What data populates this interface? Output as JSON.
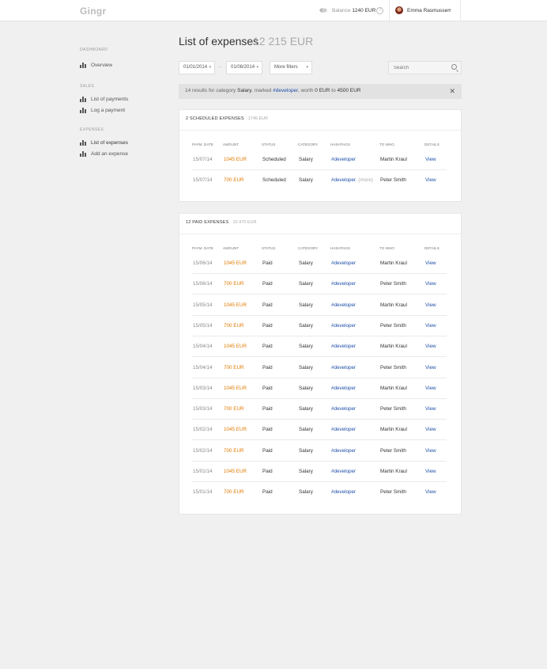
{
  "header": {
    "logo": "Gingr",
    "balance_label": "Balance",
    "balance_value": "1240 EUR",
    "help": "?",
    "user_name": "Emma Rasmussen",
    "user_caret": "▾"
  },
  "sidebar": {
    "sections": [
      {
        "title": "DASHBOARD",
        "items": [
          {
            "label": "Overview",
            "active": false
          }
        ]
      },
      {
        "title": "SALES",
        "items": [
          {
            "label": "List of payments",
            "active": false
          },
          {
            "label": "Log a payment",
            "active": false
          }
        ]
      },
      {
        "title": "EXPENSES",
        "items": [
          {
            "label": "List of expenses",
            "active": true
          },
          {
            "label": "Add an expense",
            "active": false
          }
        ]
      }
    ]
  },
  "page": {
    "title": "List of expenses",
    "total": "12 215 EUR"
  },
  "filters": {
    "date_from": "01/01/2014",
    "date_to": "01/08/2014",
    "separator": "–",
    "more_filters": "More filters",
    "caret": "▾",
    "search_placeholder": "Search"
  },
  "info_bar": {
    "part1": "14 results for category ",
    "category": "Salary",
    "part2": ", marked ",
    "tag": "#developer",
    "part3": ", worth ",
    "min": "0 EUR",
    "part4": " to ",
    "max": "4500 EUR",
    "close": "✕"
  },
  "columns": {
    "date": "PAYM. DATE",
    "amount": "AMOUNT",
    "status": "STATUS",
    "category": "CATEGORY",
    "hashtags": "HASHTAGS",
    "to_whom": "TO WHO",
    "details": "DETAILS"
  },
  "scheduled": {
    "title": "2 SCHEDULED EXPENSES",
    "sum": "1745 EUR",
    "rows": [
      {
        "date": "15/07/14",
        "amount": "1045 EUR",
        "status": "Scheduled",
        "category": "Salary",
        "tag": "#developer",
        "more": "",
        "who": "Martin Kraul",
        "view": "View"
      },
      {
        "date": "15/07/14",
        "amount": "700 EUR",
        "status": "Scheduled",
        "category": "Salary",
        "tag": "#developer",
        "more": ", (more)",
        "who": "Peter Smith",
        "view": "View"
      }
    ]
  },
  "paid": {
    "title": "12 PAID EXPENSES",
    "sum": "10 470 EUR",
    "rows": [
      {
        "date": "15/06/14",
        "amount": "1045 EUR",
        "status": "Paid",
        "category": "Salary",
        "tag": "#developer",
        "who": "Martin Kraul",
        "view": "View"
      },
      {
        "date": "15/06/14",
        "amount": "700 EUR",
        "status": "Paid",
        "category": "Salary",
        "tag": "#developer",
        "who": "Peter Smith",
        "view": "View"
      },
      {
        "date": "15/05/14",
        "amount": "1045 EUR",
        "status": "Paid",
        "category": "Salary",
        "tag": "#developer",
        "who": "Martin Kraul",
        "view": "View"
      },
      {
        "date": "15/05/14",
        "amount": "700 EUR",
        "status": "Paid",
        "category": "Salary",
        "tag": "#developer",
        "who": "Peter Smith",
        "view": "View"
      },
      {
        "date": "15/04/14",
        "amount": "1045 EUR",
        "status": "Paid",
        "category": "Salary",
        "tag": "#developer",
        "who": "Martin Kraul",
        "view": "View"
      },
      {
        "date": "15/04/14",
        "amount": "700 EUR",
        "status": "Paid",
        "category": "Salary",
        "tag": "#developer",
        "who": "Peter Smith",
        "view": "View"
      },
      {
        "date": "15/03/14",
        "amount": "1045 EUR",
        "status": "Paid",
        "category": "Salary",
        "tag": "#developer",
        "who": "Martin Kraul",
        "view": "View"
      },
      {
        "date": "15/03/14",
        "amount": "700 EUR",
        "status": "Paid",
        "category": "Salary",
        "tag": "#developer",
        "who": "Peter Smith",
        "view": "View"
      },
      {
        "date": "15/02/14",
        "amount": "1045 EUR",
        "status": "Paid",
        "category": "Salary",
        "tag": "#developer",
        "who": "Martin Kraul",
        "view": "View"
      },
      {
        "date": "15/02/14",
        "amount": "700 EUR",
        "status": "Paid",
        "category": "Salary",
        "tag": "#developer",
        "who": "Peter Smith",
        "view": "View"
      },
      {
        "date": "15/01/14",
        "amount": "1045 EUR",
        "status": "Paid",
        "category": "Salary",
        "tag": "#developer",
        "who": "Martin Kraul",
        "view": "View"
      },
      {
        "date": "15/01/14",
        "amount": "700 EUR",
        "status": "Paid",
        "category": "Salary",
        "tag": "#developer",
        "who": "Peter Smith",
        "view": "View"
      }
    ]
  },
  "colors": {
    "amount": "#e07a00",
    "link": "#1e4fa8",
    "background": "#f0f0f0",
    "card": "#ffffff"
  }
}
